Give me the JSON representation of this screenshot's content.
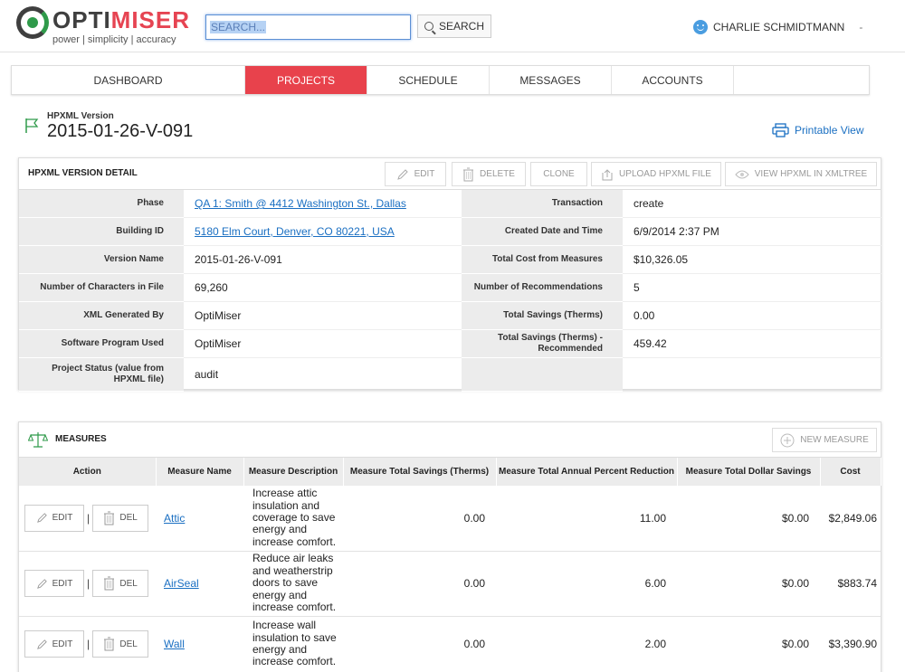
{
  "header": {
    "logo_opti": "OPTI",
    "logo_miser": "MISER",
    "logo_tagline": "power | simplicity | accuracy",
    "search_placeholder": "SEARCH...",
    "search_button": "SEARCH",
    "user_name": "CHARLIE SCHMIDTMANN",
    "user_caret": "-"
  },
  "nav": {
    "items": [
      "DASHBOARD",
      "PROJECTS",
      "SCHEDULE",
      "MESSAGES",
      "ACCOUNTS"
    ],
    "active": "PROJECTS"
  },
  "page": {
    "version_label": "HPXML Version",
    "version_title": "2015-01-26-V-091",
    "printable_view": "Printable View"
  },
  "detail": {
    "title": "HPXML VERSION DETAIL",
    "buttons": {
      "edit": "EDIT",
      "delete": "DELETE",
      "clone": "CLONE",
      "upload": "UPLOAD HPXML FILE",
      "view": "VIEW HPXML IN XMLTREE"
    },
    "left": [
      {
        "label": "Phase",
        "value": "QA 1: Smith @ 4412 Washington St., Dallas"
      },
      {
        "label": "Building ID",
        "value": "5180 Elm Court, Denver, CO 80221, USA"
      },
      {
        "label": "Version Name",
        "value": "2015-01-26-V-091"
      },
      {
        "label": "Number of Characters in File",
        "value": "69,260"
      },
      {
        "label": "XML Generated By",
        "value": "OptiMiser"
      },
      {
        "label": "Software Program Used",
        "value": "OptiMiser"
      },
      {
        "label": "Project Status (value from HPXML file)",
        "value": "audit"
      }
    ],
    "right": [
      {
        "label": "Transaction",
        "value": "create"
      },
      {
        "label": "Created Date and Time",
        "value": "6/9/2014 2:37 PM"
      },
      {
        "label": "Total Cost from Measures",
        "value": "$10,326.05"
      },
      {
        "label": "Number of Recommendations",
        "value": "5"
      },
      {
        "label": "Total Savings (Therms)",
        "value": "0.00"
      },
      {
        "label": "Total Savings (Therms) - Recommended",
        "value": "459.42"
      },
      {
        "label": "",
        "value": ""
      }
    ]
  },
  "measures": {
    "title": "MEASURES",
    "new_button": "NEW MEASURE",
    "columns": [
      "Action",
      "Measure Name",
      "Measure Description",
      "Measure Total Savings (Therms)",
      "Measure Total Annual Percent Reduction",
      "Measure Total Dollar Savings",
      "Cost"
    ],
    "row_edit": "EDIT",
    "row_del": "DEL",
    "row_sep": "|",
    "rows": [
      {
        "name": "Attic",
        "desc": [
          "Increase attic",
          "insulation and",
          "coverage to save",
          "energy and",
          "increase comfort."
        ],
        "therms": "0.00",
        "percent": "11.00",
        "dollar": "$0.00",
        "cost": "$2,849.06"
      },
      {
        "name": "AirSeal",
        "desc": [
          "Reduce air leaks",
          "and weatherstrip",
          "doors to save",
          "energy and",
          "increase comfort."
        ],
        "therms": "0.00",
        "percent": "6.00",
        "dollar": "$0.00",
        "cost": "$883.74"
      },
      {
        "name": "Wall",
        "desc": [
          "Increase wall",
          "insulation to save",
          "energy and",
          "increase comfort."
        ],
        "therms": "0.00",
        "percent": "2.00",
        "dollar": "$0.00",
        "cost": "$3,390.90"
      }
    ]
  }
}
